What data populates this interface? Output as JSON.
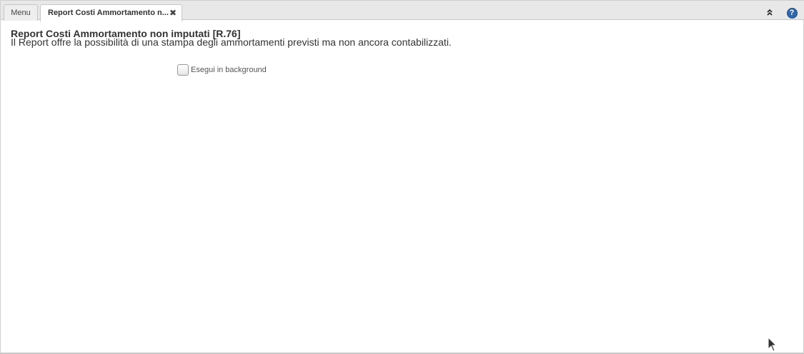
{
  "tabs": [
    {
      "label": "Menu",
      "closable": false,
      "active": false
    },
    {
      "label": "Report Costi Ammortamento n...",
      "closable": true,
      "active": true
    }
  ],
  "tab_close_glyph": "✖",
  "toolbar": {
    "collapse_icon": "double-chevron-up-icon",
    "help_icon": "help-icon",
    "help_glyph": "?"
  },
  "report": {
    "title": "Report Costi Ammortamento non imputati [R.76]",
    "description": "Il Report offre la possibilità di una stampa degli ammortamenti previsti ma non ancora contabilizzati.",
    "background_option": {
      "label": "Esegui in background",
      "checked": false
    }
  },
  "colors": {
    "tab_bar": "#e8e8e8",
    "help_accent": "#2f67a8",
    "text": "#333333"
  }
}
